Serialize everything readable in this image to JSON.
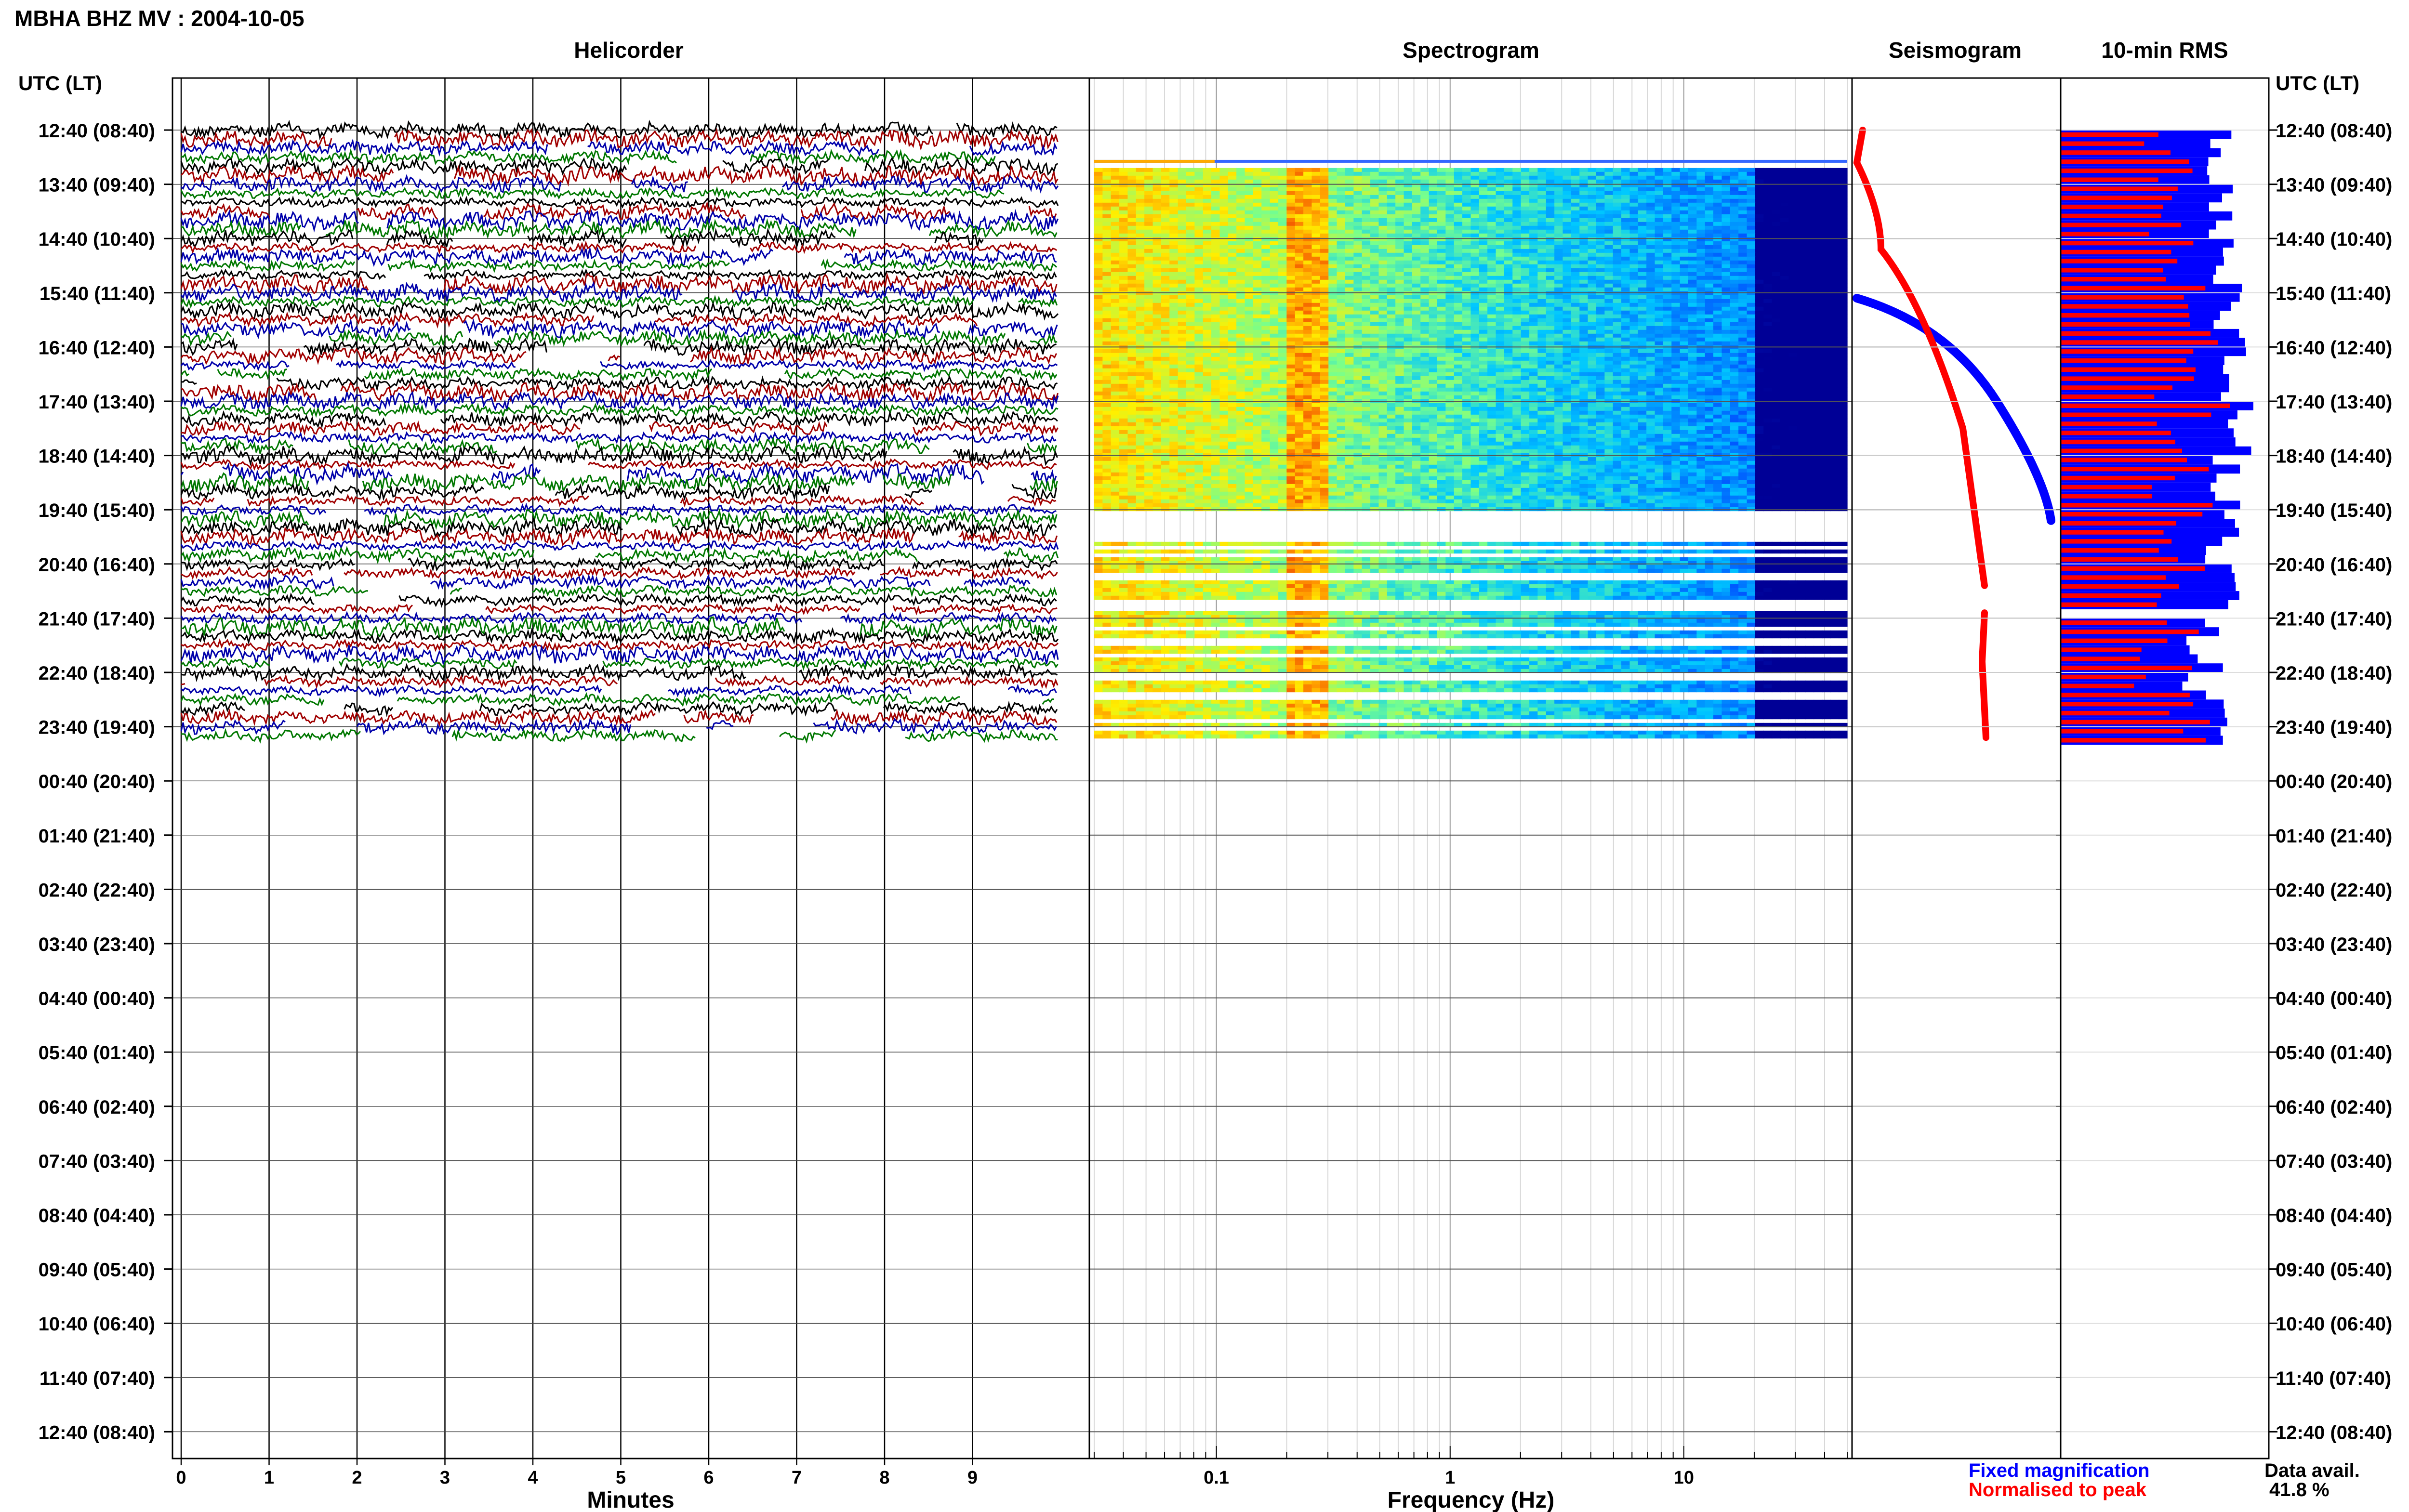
{
  "header": {
    "station_title": "MBHA BHZ MV : 2004-10-05"
  },
  "panels": {
    "helicorder": "Helicorder",
    "spectrogram": "Spectrogram",
    "seismogram": "Seismogram",
    "rms": "10-min RMS"
  },
  "time_axis": {
    "left_label": "UTC (LT)",
    "right_label": "UTC (LT)",
    "ticks": [
      "12:40 (08:40)",
      "13:40 (09:40)",
      "14:40 (10:40)",
      "15:40 (11:40)",
      "16:40 (12:40)",
      "17:40 (13:40)",
      "18:40 (14:40)",
      "19:40 (15:40)",
      "20:40 (16:40)",
      "21:40 (17:40)",
      "22:40 (18:40)",
      "23:40 (19:40)",
      "00:40 (20:40)",
      "01:40 (21:40)",
      "02:40 (22:40)",
      "03:40 (23:40)",
      "04:40 (00:40)",
      "05:40 (01:40)",
      "06:40 (02:40)",
      "07:40 (03:40)",
      "08:40 (04:40)",
      "09:40 (05:40)",
      "10:40 (06:40)",
      "11:40 (07:40)",
      "12:40 (08:40)"
    ]
  },
  "legend": {
    "fixed": "Fixed magnification",
    "normalised": "Normalised to peak",
    "fixed_color": "#0000ff",
    "normalised_color": "#ff0000"
  },
  "availability": {
    "label": "Data avail.",
    "value": "41.8 %"
  },
  "colors": {
    "trace_cycle": [
      "#000000",
      "#a00000",
      "#0000aa",
      "#007700"
    ],
    "fixed": "#0000ff",
    "normalised": "#ff0000"
  },
  "chart_data": [
    {
      "type": "line",
      "title": "Helicorder",
      "xlabel": "Minutes",
      "x_ticks": [
        0,
        1,
        2,
        3,
        4,
        5,
        6,
        7,
        8,
        9
      ],
      "xlim": [
        0,
        10
      ],
      "row_interval_minutes": 10,
      "rows_with_data_hours": [
        "12:40",
        "23:50"
      ],
      "trace_colors_cycle": [
        "black",
        "dark red",
        "blue",
        "green"
      ]
    },
    {
      "type": "heatmap",
      "title": "Spectrogram",
      "xlabel": "Frequency (Hz)",
      "x_scale": "log",
      "x_ticks": [
        0.1,
        1,
        10
      ],
      "xlim": [
        0.03,
        50
      ],
      "peak_band_hz": [
        0.2,
        0.3
      ],
      "data_hours": [
        "12:40",
        "23:50"
      ]
    },
    {
      "type": "line",
      "title": "Seismogram",
      "series": [
        {
          "name": "Fixed magnification",
          "color": "blue"
        },
        {
          "name": "Normalised to peak",
          "color": "red"
        }
      ]
    },
    {
      "type": "bar",
      "title": "10-min RMS",
      "orientation": "horizontal",
      "series": [
        {
          "name": "Fixed magnification",
          "color": "blue"
        },
        {
          "name": "Normalised to peak",
          "color": "red"
        }
      ],
      "data_availability_percent": 41.8
    }
  ]
}
